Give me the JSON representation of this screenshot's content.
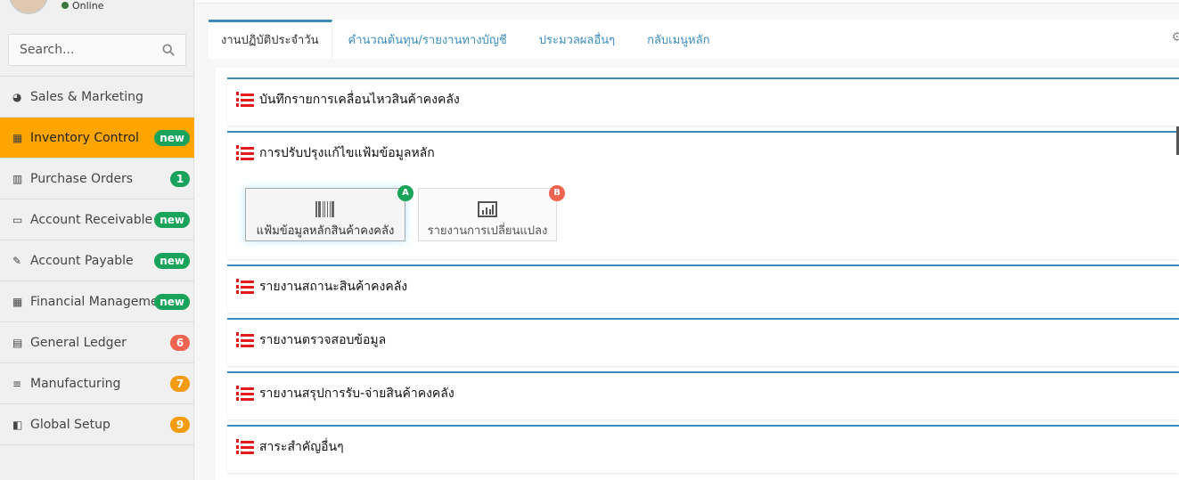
{
  "user": {
    "status": "Online"
  },
  "search": {
    "placeholder": "Search..."
  },
  "menu": [
    {
      "label": "Sales & Marketing",
      "icon": "dashboard-icon",
      "badge": null
    },
    {
      "label": "Inventory Control",
      "icon": "grid-icon",
      "badge": "new",
      "badge_color": "#1aa35a",
      "active": true
    },
    {
      "label": "Purchase Orders",
      "icon": "bar-chart-icon",
      "badge": "1",
      "badge_color": "#1aa35a"
    },
    {
      "label": "Account Receivable",
      "icon": "laptop-icon",
      "badge": "new",
      "badge_color": "#1aa35a"
    },
    {
      "label": "Account Payable",
      "icon": "edit-icon",
      "badge": "new",
      "badge_color": "#1aa35a"
    },
    {
      "label": "Financial Management",
      "icon": "calendar-icon",
      "badge": "new",
      "badge_color": "#1aa35a"
    },
    {
      "label": "General Ledger",
      "icon": "building-icon",
      "badge": "6",
      "badge_color": "#ef6450"
    },
    {
      "label": "Manufacturing",
      "icon": "server-icon",
      "badge": "7",
      "badge_color": "#f39c12"
    },
    {
      "label": "Global Setup",
      "icon": "layout-icon",
      "badge": "9",
      "badge_color": "#f39c12"
    }
  ],
  "tabs": [
    "งานปฏิบัติประจำวัน",
    "คำนวณต้นทุน/รายงานทางบัญชี",
    "ประมวลผลอื่นๆ",
    "กลับเมนูหลัก"
  ],
  "sections": [
    "บันทึกรายการเคลื่อนไหวสินค้าคงคลัง",
    "การปรับปรุงแก้ไขแฟ้มข้อมูลหลัก",
    "รายงานสถานะสินค้าคงคลัง",
    "รายงานตรวจสอบข้อมูล",
    "รายงานสรุปการรับ-จ่ายสินค้าคงคลัง",
    "สาระสำคัญอื่นๆ"
  ],
  "buttons": [
    {
      "label": "แฟ้มข้อมูลหลักสินค้าคงคลัง",
      "badge": "A",
      "icon": "barcode-icon"
    },
    {
      "label": "รายงานการเปลี่ยนแปลง",
      "badge": "B",
      "icon": "report-chart-icon"
    }
  ],
  "colors": {
    "accent": "#3c8dbc",
    "active": "#ffa500"
  }
}
